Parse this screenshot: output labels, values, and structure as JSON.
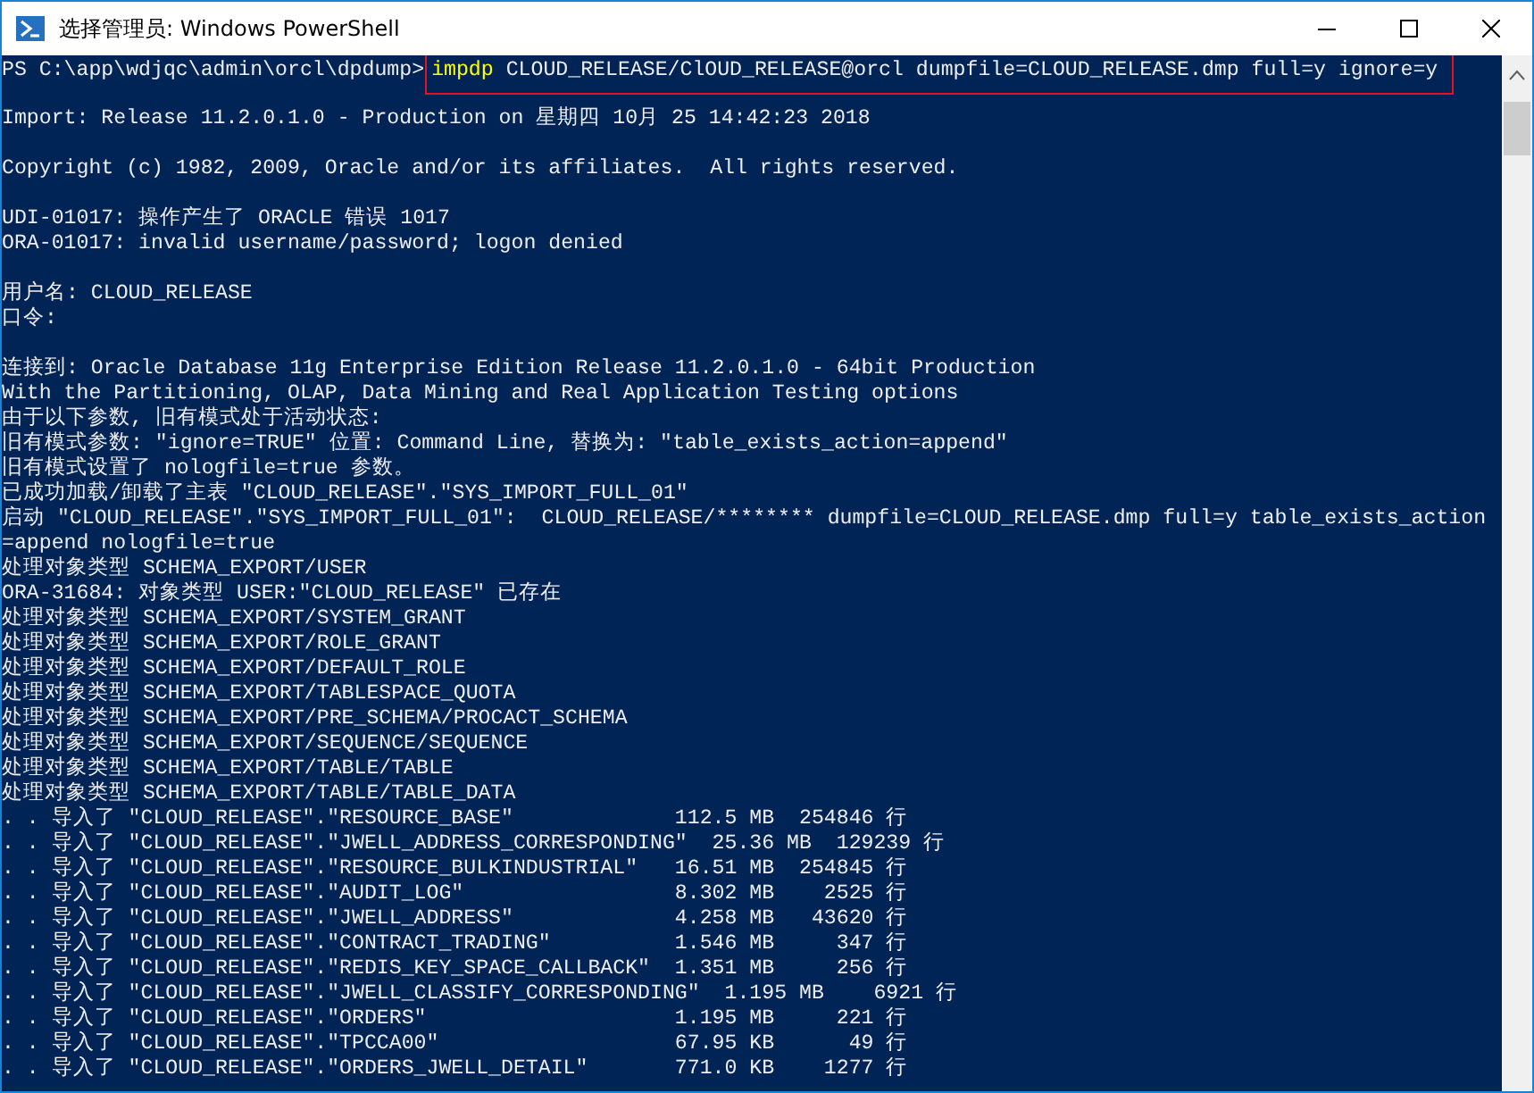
{
  "window": {
    "title": "选择管理员: Windows PowerShell"
  },
  "prompt": {
    "path": "PS C:\\app\\wdjqc\\admin\\orcl\\dpdump>",
    "command": "impdp",
    "arguments": "CLOUD_RELEASE/ClOUD_RELEASE@orcl dumpfile=CLOUD_RELEASE.dmp full=y ignore=y",
    "highlighted": true
  },
  "lines": [
    {
      "kind": "blank"
    },
    {
      "kind": "text",
      "text": "Import: Release 11.2.0.1.0 - Production on 星期四 10月 25 14:42:23 2018"
    },
    {
      "kind": "blank"
    },
    {
      "kind": "text",
      "text": "Copyright (c) 1982, 2009, Oracle and/or its affiliates.  All rights reserved."
    },
    {
      "kind": "blank"
    },
    {
      "kind": "text",
      "text": "UDI-01017: 操作产生了 ORACLE 错误 1017"
    },
    {
      "kind": "text",
      "text": "ORA-01017: invalid username/password; logon denied"
    },
    {
      "kind": "blank"
    },
    {
      "kind": "text",
      "text": "用户名: CLOUD_RELEASE"
    },
    {
      "kind": "text",
      "text": "口令:"
    },
    {
      "kind": "blank"
    },
    {
      "kind": "text",
      "text": "连接到: Oracle Database 11g Enterprise Edition Release 11.2.0.1.0 - 64bit Production"
    },
    {
      "kind": "text",
      "text": "With the Partitioning, OLAP, Data Mining and Real Application Testing options"
    },
    {
      "kind": "text",
      "text": "由于以下参数, 旧有模式处于活动状态:"
    },
    {
      "kind": "text",
      "text": "旧有模式参数: ″ignore=TRUE″ 位置: Command Line, 替换为: ″table_exists_action=append″"
    },
    {
      "kind": "text",
      "text": "旧有模式设置了 nologfile=true 参数。"
    },
    {
      "kind": "text",
      "text": "已成功加载/卸载了主表 ″CLOUD_RELEASE″.″SYS_IMPORT_FULL_01″"
    },
    {
      "kind": "text",
      "text": "启动 ″CLOUD_RELEASE″.″SYS_IMPORT_FULL_01″:  CLOUD_RELEASE/******** dumpfile=CLOUD_RELEASE.dmp full=y table_exists_action"
    },
    {
      "kind": "text",
      "text": "=append nologfile=true"
    },
    {
      "kind": "text",
      "text": "处理对象类型 SCHEMA_EXPORT/USER"
    },
    {
      "kind": "text",
      "text": "ORA-31684: 对象类型 USER:″CLOUD_RELEASE″ 已存在"
    },
    {
      "kind": "text",
      "text": "处理对象类型 SCHEMA_EXPORT/SYSTEM_GRANT"
    },
    {
      "kind": "text",
      "text": "处理对象类型 SCHEMA_EXPORT/ROLE_GRANT"
    },
    {
      "kind": "text",
      "text": "处理对象类型 SCHEMA_EXPORT/DEFAULT_ROLE"
    },
    {
      "kind": "text",
      "text": "处理对象类型 SCHEMA_EXPORT/TABLESPACE_QUOTA"
    },
    {
      "kind": "text",
      "text": "处理对象类型 SCHEMA_EXPORT/PRE_SCHEMA/PROCACT_SCHEMA"
    },
    {
      "kind": "text",
      "text": "处理对象类型 SCHEMA_EXPORT/SEQUENCE/SEQUENCE"
    },
    {
      "kind": "text",
      "text": "处理对象类型 SCHEMA_EXPORT/TABLE/TABLE"
    },
    {
      "kind": "text",
      "text": "处理对象类型 SCHEMA_EXPORT/TABLE/TABLE_DATA"
    },
    {
      "kind": "text",
      "text": ". . 导入了 ″CLOUD_RELEASE″.″RESOURCE_BASE″             112.5 MB  254846 行"
    },
    {
      "kind": "text",
      "text": ". . 导入了 ″CLOUD_RELEASE″.″JWELL_ADDRESS_CORRESPONDING″  25.36 MB  129239 行"
    },
    {
      "kind": "text",
      "text": ". . 导入了 ″CLOUD_RELEASE″.″RESOURCE_BULKINDUSTRIAL″   16.51 MB  254845 行"
    },
    {
      "kind": "text",
      "text": ". . 导入了 ″CLOUD_RELEASE″.″AUDIT_LOG″                 8.302 MB    2525 行"
    },
    {
      "kind": "text",
      "text": ". . 导入了 ″CLOUD_RELEASE″.″JWELL_ADDRESS″             4.258 MB   43620 行"
    },
    {
      "kind": "text",
      "text": ". . 导入了 ″CLOUD_RELEASE″.″CONTRACT_TRADING″          1.546 MB     347 行"
    },
    {
      "kind": "text",
      "text": ". . 导入了 ″CLOUD_RELEASE″.″REDIS_KEY_SPACE_CALLBACK″  1.351 MB     256 行"
    },
    {
      "kind": "text",
      "text": ". . 导入了 ″CLOUD_RELEASE″.″JWELL_CLASSIFY_CORRESPONDING″  1.195 MB    6921 行"
    },
    {
      "kind": "text",
      "text": ". . 导入了 ″CLOUD_RELEASE″.″ORDERS″                    1.195 MB     221 行"
    },
    {
      "kind": "text",
      "text": ". . 导入了 ″CLOUD_RELEASE″.″TPCCA00″                   67.95 KB      49 行"
    },
    {
      "kind": "text",
      "text": ". . 导入了 ″CLOUD_RELEASE″.″ORDERS_JWELL_DETAIL″       771.0 KB    1277 行"
    }
  ]
}
